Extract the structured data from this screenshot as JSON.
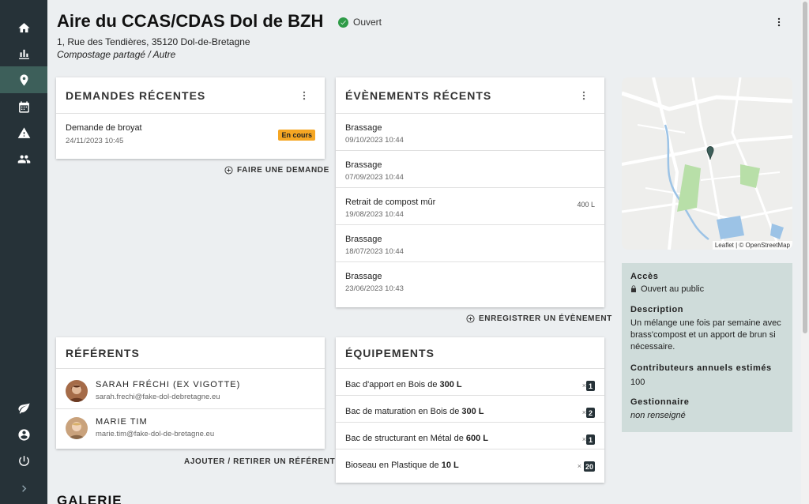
{
  "nav": {
    "items": [
      {
        "name": "home-icon"
      },
      {
        "name": "stats-icon"
      },
      {
        "name": "map-pin-icon"
      },
      {
        "name": "calendar-icon"
      },
      {
        "name": "warning-icon"
      },
      {
        "name": "users-icon"
      }
    ],
    "bottom": [
      {
        "name": "leaf-icon"
      },
      {
        "name": "account-icon"
      },
      {
        "name": "power-icon"
      },
      {
        "name": "chevron-right-icon"
      }
    ]
  },
  "header": {
    "title": "Aire du CCAS/CDAS Dol de BZH",
    "status": "Ouvert",
    "address": "1, Rue des Tendières, 35120 Dol-de-Bretagne",
    "subtype": "Compostage partagé / Autre"
  },
  "demandes": {
    "title": "DEMANDES RÉCENTES",
    "items": [
      {
        "title": "Demande de broyat",
        "date": "24/11/2023 10:45",
        "badge": "En cours"
      }
    ],
    "action": "FAIRE UNE DEMANDE"
  },
  "evenements": {
    "title": "ÉVÈNEMENTS RÉCENTS",
    "items": [
      {
        "title": "Brassage",
        "date": "09/10/2023 10:44",
        "qty": ""
      },
      {
        "title": "Brassage",
        "date": "07/09/2023 10:44",
        "qty": ""
      },
      {
        "title": "Retrait de compost mûr",
        "date": "19/08/2023 10:44",
        "qty": "400 L"
      },
      {
        "title": "Brassage",
        "date": "18/07/2023 10:44",
        "qty": ""
      },
      {
        "title": "Brassage",
        "date": "23/06/2023 10:43",
        "qty": ""
      }
    ],
    "action": "ENREGISTRER UN ÉVÈNEMENT"
  },
  "referents": {
    "title": "RÉFÉRENTS",
    "items": [
      {
        "name": "SARAH FRÉCHI (EX VIGOTTE)",
        "email": "sarah.frechi@fake-dol-debretagne.eu"
      },
      {
        "name": "MARIE TIM",
        "email": "marie.tim@fake-dol-de-bretagne.eu"
      }
    ],
    "action": "AJOUTER / RETIRER UN RÉFÉRENT"
  },
  "equipements": {
    "title": "ÉQUIPEMENTS",
    "items": [
      {
        "prefix": "Bac d'apport en Bois de ",
        "size": "300 L",
        "count": "1"
      },
      {
        "prefix": "Bac de maturation en Bois de ",
        "size": "300 L",
        "count": "2"
      },
      {
        "prefix": "Bac de structurant en Métal de ",
        "size": "600 L",
        "count": "1"
      },
      {
        "prefix": "Bioseau en Plastique de ",
        "size": "10 L",
        "count": "20"
      }
    ],
    "times": "×"
  },
  "map": {
    "attribution": "Leaflet | © OpenStreetMap"
  },
  "info": {
    "acces_label": "Accès",
    "acces_value": "Ouvert au public",
    "description_label": "Description",
    "description_value": "Un mélange une fois par semaine avec brass'compost et un apport de brun si nécessaire.",
    "contrib_label": "Contributeurs annuels estimés",
    "contrib_value": "100",
    "gestionnaire_label": "Gestionnaire",
    "gestionnaire_value": "non renseigné"
  },
  "gallery": {
    "title": "GALERIE"
  },
  "colors": {
    "sidebar": "#263238",
    "active": "#3d5f5a",
    "status_green": "#2e9b47",
    "badge_warning": "#f5a623",
    "info_panel": "#cfdcda"
  }
}
